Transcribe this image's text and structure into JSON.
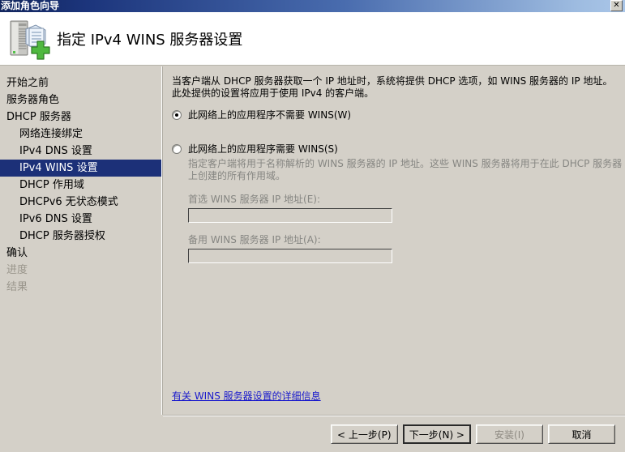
{
  "window": {
    "title": "添加角色向导",
    "close_label": "✕",
    "close_icon": "close-icon"
  },
  "header": {
    "title": "指定 IPv4 WINS 服务器设置",
    "icon": "server-add-icon"
  },
  "sidebar": {
    "items": [
      {
        "label": "开始之前",
        "indent": false,
        "selected": false,
        "disabled": false
      },
      {
        "label": "服务器角色",
        "indent": false,
        "selected": false,
        "disabled": false
      },
      {
        "label": "DHCP 服务器",
        "indent": false,
        "selected": false,
        "disabled": false
      },
      {
        "label": "网络连接绑定",
        "indent": true,
        "selected": false,
        "disabled": false
      },
      {
        "label": "IPv4 DNS 设置",
        "indent": true,
        "selected": false,
        "disabled": false
      },
      {
        "label": "IPv4 WINS 设置",
        "indent": true,
        "selected": true,
        "disabled": false
      },
      {
        "label": "DHCP 作用域",
        "indent": true,
        "selected": false,
        "disabled": false
      },
      {
        "label": "DHCPv6 无状态模式",
        "indent": true,
        "selected": false,
        "disabled": false
      },
      {
        "label": "IPv6 DNS 设置",
        "indent": true,
        "selected": false,
        "disabled": false
      },
      {
        "label": "DHCP 服务器授权",
        "indent": true,
        "selected": false,
        "disabled": false
      },
      {
        "label": "确认",
        "indent": false,
        "selected": false,
        "disabled": false
      },
      {
        "label": "进度",
        "indent": false,
        "selected": false,
        "disabled": true
      },
      {
        "label": "结果",
        "indent": false,
        "selected": false,
        "disabled": true
      }
    ]
  },
  "main": {
    "intro": "当客户端从 DHCP 服务器获取一个 IP 地址时，系统将提供 DHCP 选项，如 WINS 服务器的 IP 地址。此处提供的设置将应用于使用 IPv4 的客户端。",
    "option_not_required": {
      "label": "此网络上的应用程序不需要 WINS(W)",
      "selected": true
    },
    "option_required": {
      "label": "此网络上的应用程序需要 WINS(S)",
      "selected": false,
      "description": "指定客户端将用于名称解析的 WINS 服务器的 IP 地址。这些 WINS 服务器将用于在此 DHCP 服务器上创建的所有作用域。"
    },
    "preferred_field": {
      "label": "首选 WINS 服务器 IP 地址(E):",
      "value": "",
      "placeholder": ""
    },
    "alternate_field": {
      "label": "备用 WINS 服务器 IP 地址(A):",
      "value": "",
      "placeholder": ""
    },
    "help_link": "有关 WINS 服务器设置的详细信息"
  },
  "footer": {
    "previous": "< 上一步(P)",
    "next": "下一步(N) >",
    "install": "安装(I)",
    "cancel": "取消"
  },
  "colors": {
    "dialog_bg": "#d4d0c8",
    "titlebar_start": "#12265e",
    "titlebar_end": "#aac6e8",
    "selection_bg": "#1c3078",
    "link": "#1919cc",
    "disabled_text": "#868682"
  }
}
